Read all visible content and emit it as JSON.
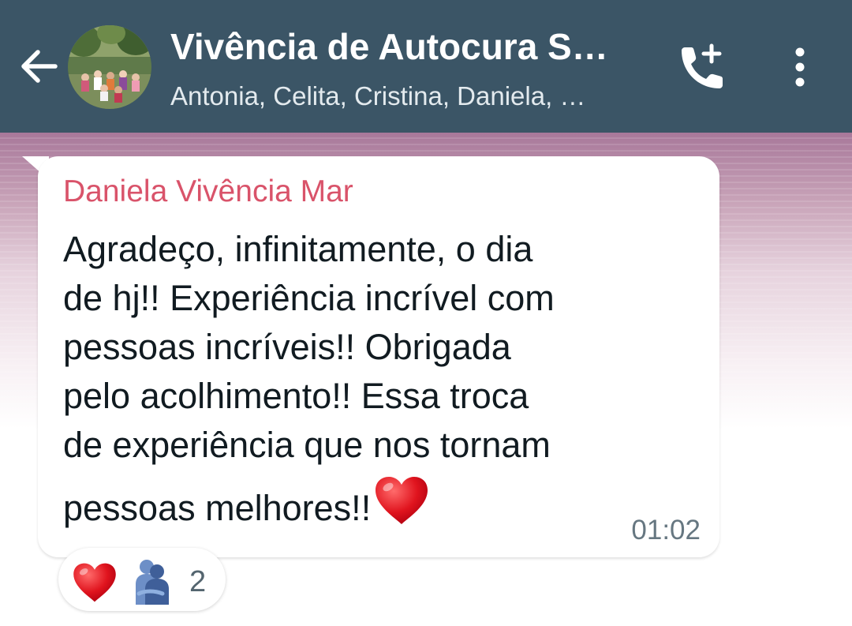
{
  "header": {
    "title": "Vivência de Autocura S…",
    "subtitle": "Antonia, Celita, Cristina, Daniela, …",
    "back_icon": "arrow-left-icon",
    "call_icon": "add-call-icon",
    "menu_icon": "more-vert-icon",
    "bar_color": "#3b5566"
  },
  "message": {
    "sender": "Daniela Vivência Mar",
    "lines": [
      "Agradeço, infinitamente, o dia",
      "de hj!! Experiência incrível com",
      "pessoas incríveis!! Obrigada",
      "pelo acolhimento!! Essa troca",
      "de experiência que nos tornam",
      "pessoas melhores!!"
    ],
    "emoji": "red-heart-icon",
    "time": "01:02",
    "sender_color": "#d9536a"
  },
  "reactions": {
    "emojis": [
      "red-heart-icon",
      "people-hugging-icon"
    ],
    "count": "2"
  }
}
